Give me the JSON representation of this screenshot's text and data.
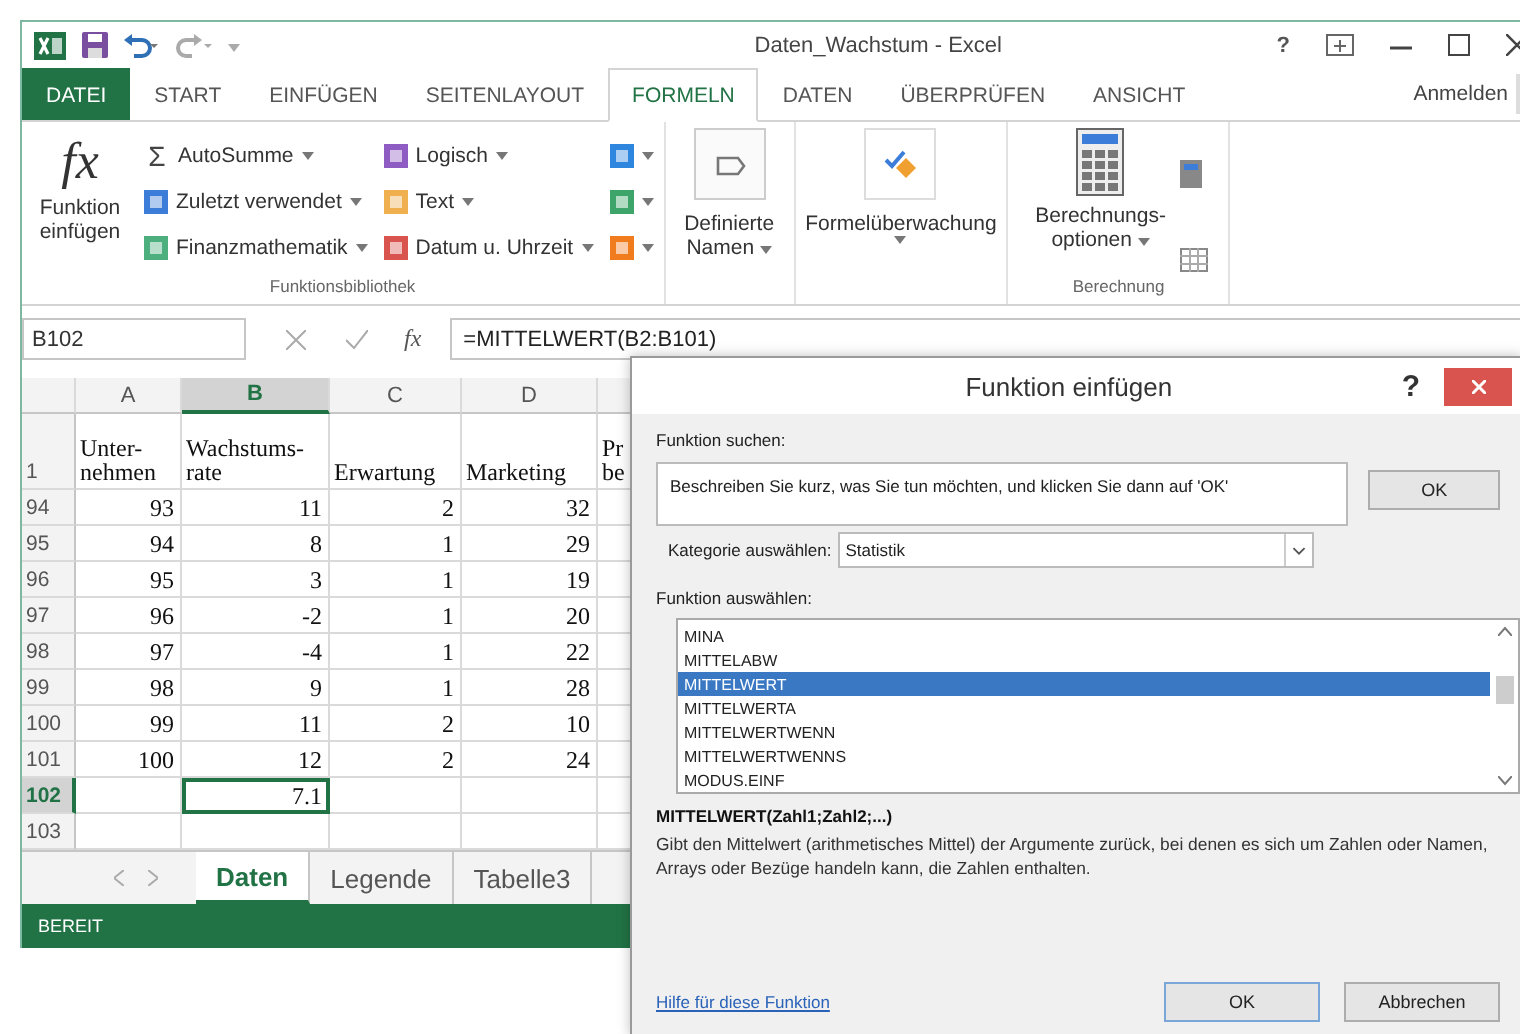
{
  "window": {
    "title": "Daten_Wachstum - Excel",
    "help": "?"
  },
  "ribbon_tabs": [
    {
      "label": "DATEI",
      "kind": "file",
      "selected": false
    },
    {
      "label": "START",
      "kind": "tab",
      "selected": false
    },
    {
      "label": "EINFÜGEN",
      "kind": "tab",
      "selected": false
    },
    {
      "label": "SEITENLAYOUT",
      "kind": "tab",
      "selected": false
    },
    {
      "label": "FORMELN",
      "kind": "tab",
      "selected": true
    },
    {
      "label": "DATEN",
      "kind": "tab",
      "selected": false
    },
    {
      "label": "ÜBERPRÜFEN",
      "kind": "tab",
      "selected": false
    },
    {
      "label": "ANSICHT",
      "kind": "tab",
      "selected": false
    }
  ],
  "account": "Anmelden",
  "ribbon": {
    "insert_function_symbol": "fx",
    "insert_function": "Funktion einfügen",
    "library_columns": [
      [
        {
          "label": "AutoSumme",
          "kind": "symbol",
          "symbol": "Σ"
        },
        {
          "label": "Zuletzt verwendet",
          "kind": "square",
          "color": "#3b7dd8"
        },
        {
          "label": "Finanzmathematik",
          "kind": "square",
          "color": "#4caf7d"
        }
      ],
      [
        {
          "label": "Logisch",
          "kind": "square",
          "color": "#8e5cc2"
        },
        {
          "label": "Text",
          "kind": "square",
          "color": "#f0b050"
        },
        {
          "label": "Datum u. Uhrzeit",
          "kind": "square",
          "color": "#d9534f"
        }
      ]
    ],
    "library_icon_buttons": [
      {
        "color": "#2e86de"
      },
      {
        "color": "#3da56a"
      },
      {
        "color": "#f07c1e"
      }
    ],
    "library_label": "Funktionsbibliothek",
    "names_button": "Definierte Namen",
    "audit_button": "Formelüberwachung",
    "calc_button": "Berechnungs- optionen",
    "calc_label": "Berechnung"
  },
  "formula_bar": {
    "name_box": "B102",
    "fx": "fx",
    "formula": "=MITTELWERT(B2:B101)"
  },
  "sheet": {
    "columns": [
      {
        "letter": "A",
        "selected": false
      },
      {
        "letter": "B",
        "selected": true
      },
      {
        "letter": "C",
        "selected": false
      },
      {
        "letter": "D",
        "selected": false
      }
    ],
    "header_row": {
      "row": "1",
      "cells": [
        "Unter- nehmen",
        "Wachstums- rate",
        "Erwartung",
        "Marketing",
        "Pr be"
      ]
    },
    "rows": [
      {
        "row": "94",
        "selected": false,
        "cells": [
          "93",
          "11",
          "2",
          "32"
        ]
      },
      {
        "row": "95",
        "selected": false,
        "cells": [
          "94",
          "8",
          "1",
          "29"
        ]
      },
      {
        "row": "96",
        "selected": false,
        "cells": [
          "95",
          "3",
          "1",
          "19"
        ]
      },
      {
        "row": "97",
        "selected": false,
        "cells": [
          "96",
          "-2",
          "1",
          "20"
        ]
      },
      {
        "row": "98",
        "selected": false,
        "cells": [
          "97",
          "-4",
          "1",
          "22"
        ]
      },
      {
        "row": "99",
        "selected": false,
        "cells": [
          "98",
          "9",
          "1",
          "28"
        ]
      },
      {
        "row": "100",
        "selected": false,
        "cells": [
          "99",
          "11",
          "2",
          "10"
        ]
      },
      {
        "row": "101",
        "selected": false,
        "cells": [
          "100",
          "12",
          "2",
          "24"
        ]
      },
      {
        "row": "102",
        "selected": true,
        "cells": [
          null,
          "7.1",
          null,
          null
        ]
      },
      {
        "row": "103",
        "selected": false
      }
    ]
  },
  "sheet_tabs": [
    {
      "label": "Daten",
      "selected": true
    },
    {
      "label": "Legende",
      "selected": false
    },
    {
      "label": "Tabelle3",
      "selected": false
    }
  ],
  "status_bar": "BEREIT",
  "dialog": {
    "title": "Funktion einfügen",
    "help": "?",
    "search_label": "Funktion suchen:",
    "search_value": "Beschreiben Sie kurz, was Sie tun möchten, und klicken Sie dann auf 'OK'",
    "search_button": "OK",
    "category_label": "Kategorie auswählen:",
    "category_value": "Statistik",
    "function_label": "Funktion auswählen:",
    "functions": [
      {
        "label": "MINA",
        "selected": false
      },
      {
        "label": "MITTELABW",
        "selected": false
      },
      {
        "label": "MITTELWERT",
        "selected": true
      },
      {
        "label": "MITTELWERTA",
        "selected": false
      },
      {
        "label": "MITTELWERTWENN",
        "selected": false
      },
      {
        "label": "MITTELWERTWENNS",
        "selected": false
      },
      {
        "label": "MODUS.EINF",
        "selected": false
      }
    ],
    "signature": "MITTELWERT(Zahl1;Zahl2;...)",
    "description": "Gibt den Mittelwert (arithmetisches Mittel) der Argumente zurück, bei denen es sich um Zahlen oder Namen, Arrays oder Bezüge handeln kann, die Zahlen enthalten.",
    "help_link": "Hilfe für diese Funktion",
    "buttons": [
      "OK",
      "Abbrechen"
    ]
  }
}
